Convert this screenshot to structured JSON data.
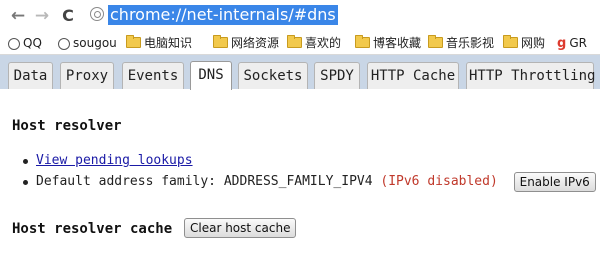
{
  "browser": {
    "back_icon": "←",
    "forward_icon": "→",
    "reload_icon": "C",
    "url": "chrome://net-internals/#dns"
  },
  "bookmarks": [
    {
      "label": "QQ",
      "icon": "round-icon"
    },
    {
      "label": "sougou",
      "icon": "round-icon"
    },
    {
      "label": "电脑知识",
      "icon": "folder-icon"
    },
    {
      "label": "网络资源",
      "icon": "folder-icon"
    },
    {
      "label": "喜欢的",
      "icon": "folder-icon"
    },
    {
      "label": "博客收藏",
      "icon": "folder-icon"
    },
    {
      "label": "音乐影视",
      "icon": "folder-icon"
    },
    {
      "label": "网购",
      "icon": "folder-icon"
    },
    {
      "label": "GR",
      "icon": "google-icon",
      "glyph": "g"
    }
  ],
  "tabs": [
    {
      "label": "Data"
    },
    {
      "label": "Proxy"
    },
    {
      "label": "Events"
    },
    {
      "label": "DNS",
      "active": true
    },
    {
      "label": "Sockets"
    },
    {
      "label": "SPDY"
    },
    {
      "label": "HTTP Cache"
    },
    {
      "label": "HTTP Throttling"
    }
  ],
  "dns": {
    "host_resolver_heading": "Host resolver",
    "view_pending_link": "View pending lookups",
    "default_family_label": "Default address family: ADDRESS_FAMILY_IPV4",
    "ipv6_status": "(IPv6 disabled)",
    "enable_ipv6_button": "Enable IPv6",
    "cache_heading": "Host resolver cache",
    "clear_cache_button": "Clear host cache"
  },
  "colors": {
    "url_highlight": "#3a86e8",
    "tab_bar_bg": "#c9d6e6",
    "link": "#1a1aa6",
    "ipv6_status": "#c0392b"
  }
}
